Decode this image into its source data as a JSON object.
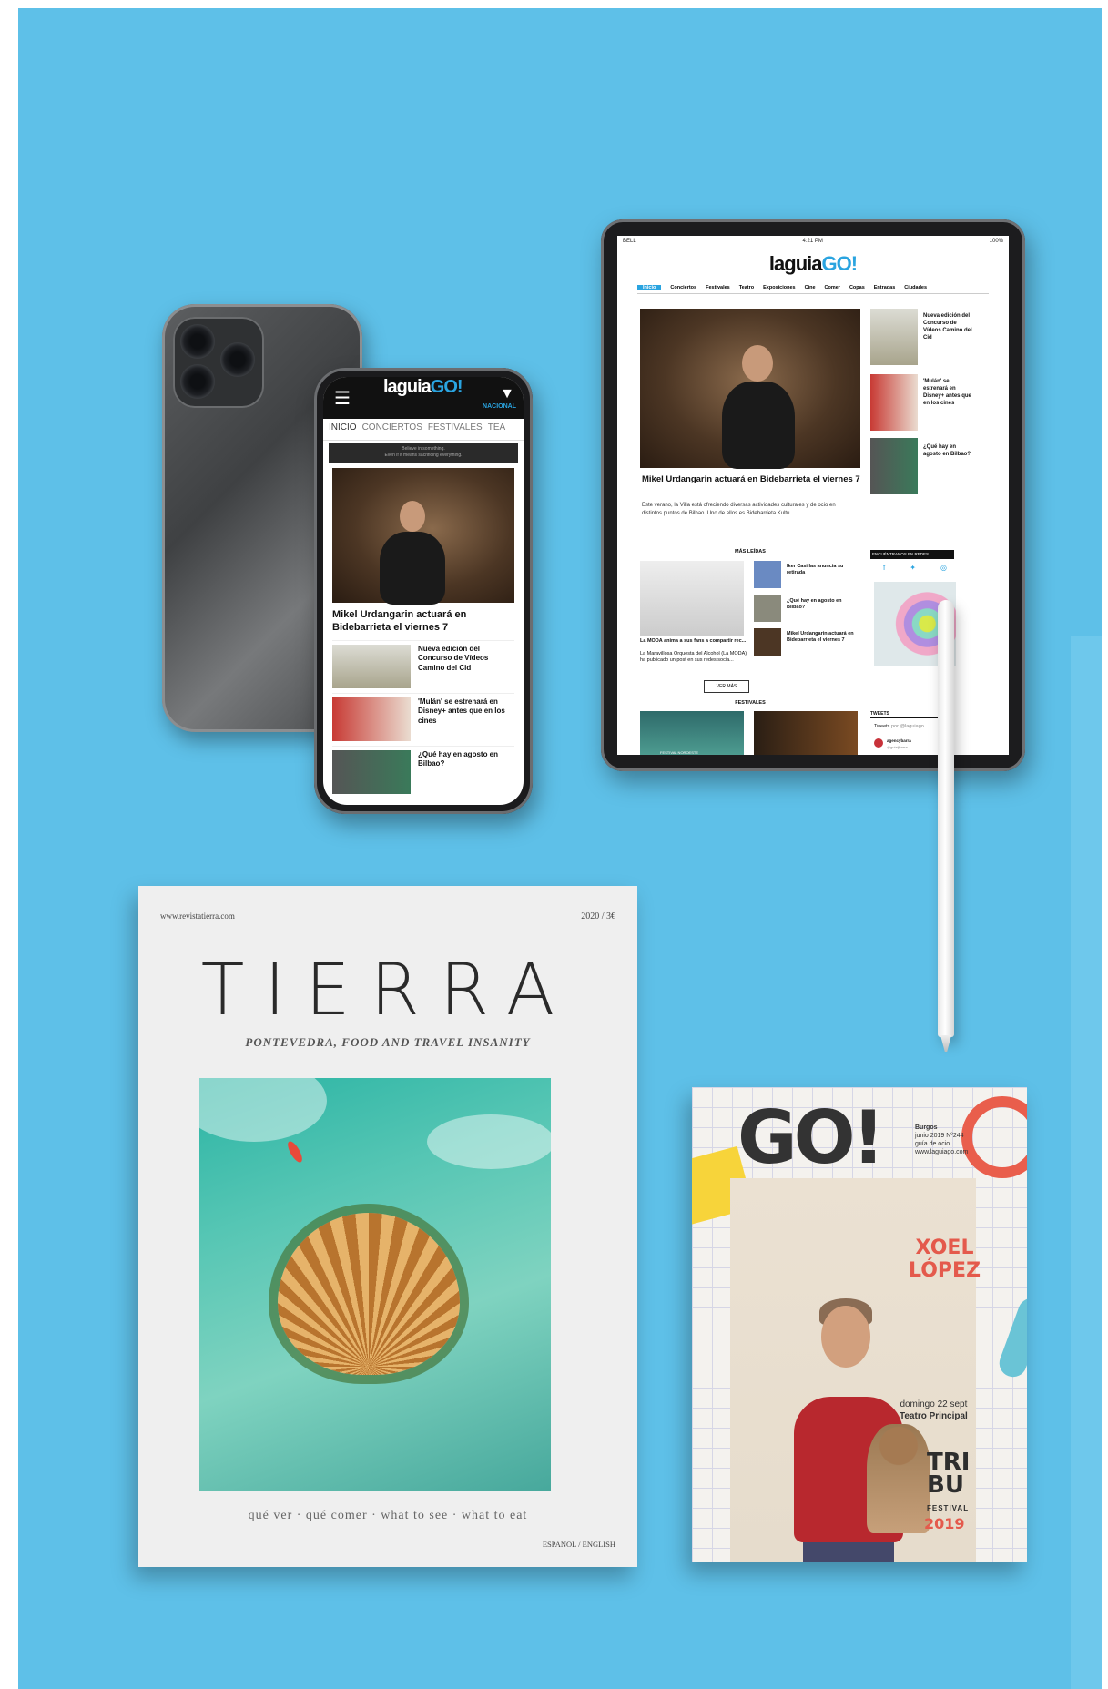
{
  "colors": {
    "background": "#5ec0e8",
    "accent": "#2aa4e0",
    "red": "#e45a4c"
  },
  "phone": {
    "logo_prefix": "laguia",
    "logo_suffix": "GO!",
    "region": "NACIONAL",
    "tabs": [
      "INICIO",
      "CONCIERTOS",
      "FESTIVALES",
      "TEA"
    ],
    "banner_line1": "Believe in something.",
    "banner_line2": "Even if it means sacrificing everything.",
    "headline": "Mikel Urdangarin actuará en Bidebarrieta el viernes 7",
    "items": [
      {
        "title": "Nueva edición del Concurso de Vídeos Camino del Cid"
      },
      {
        "title": "'Mulán' se estrenará en Disney+ antes que en los cines"
      },
      {
        "title": "¿Qué hay en agosto en Bilbao?"
      }
    ]
  },
  "tablet": {
    "status_carrier": "BELL",
    "status_time": "4:21 PM",
    "status_battery": "100%",
    "logo_prefix": "laguia",
    "logo_suffix": "GO!",
    "nav": [
      "Inicio",
      "Conciertos",
      "Festivales",
      "Teatro",
      "Exposiciones",
      "Cine",
      "Comer",
      "Copas",
      "Entradas",
      "Ciudades"
    ],
    "headline": "Mikel Urdangarin actuará en Bidebarrieta el viernes 7",
    "summary": "Este verano, la Villa está ofreciendo diversas actividades culturales y de ocio en distintos puntos de Bilbao. Uno de ellos es Bidebarrieta Kultu...",
    "side_items": [
      {
        "title": "Nueva edición del Concurso de Vídeos Camino del Cid"
      },
      {
        "title": "'Mulán' se estrenará en Disney+ antes que en los cines"
      },
      {
        "title": "¿Qué hay en agosto en Bilbao?"
      }
    ],
    "section_most_read": "MÁS LEÍDAS",
    "band_title": "La MODA anima a sus fans a compartir rec...",
    "band_text": "La Maravillosa Orquesta del Alcohol (La MODA) ha publicado un post en sus redes socia...",
    "most_read": [
      {
        "title": "Iker Casillas anuncia su retirada"
      },
      {
        "title": "¿Qué hay en agosto en Bilbao?"
      },
      {
        "title": "Mikel Urdangarin actuará en Bidebarrieta el viernes 7"
      }
    ],
    "see_more": "VER MÁS",
    "section_festivals": "FESTIVALES",
    "festival_label": "FESTIVAL NOROESTE",
    "social_title": "ENCUÉNTRANOS EN REDES",
    "tweets_title": "TWEETS",
    "tweets_by": "Tweets",
    "tweets_by_suffix": "por @laguiago",
    "tweet_user": "agencybarra",
    "tweet_handle": "@guiaijbarra"
  },
  "mag_tierra": {
    "url": "www.revistatierra.com",
    "price": "2020 / 3€",
    "title": "TIERRA",
    "subtitle": "PONTEVEDRA, FOOD AND TRAVEL INSANITY",
    "footer": "qué ver · qué comer · what to see · what to eat",
    "languages": "ESPAÑOL / ENGLISH"
  },
  "mag_go": {
    "title": "GO!",
    "city": "Burgos",
    "issue": "junio 2019 Nº244",
    "guide": "guía de ocio",
    "site": "www.laguiago.com",
    "name_line1": "XOEL",
    "name_line2": "LÓPEZ",
    "date": "domingo 22 sept",
    "venue": "Teatro Principal",
    "tribu_line1": "TRI",
    "tribu_line2": "BU",
    "festival": "FESTIVAL",
    "year": "2019"
  }
}
